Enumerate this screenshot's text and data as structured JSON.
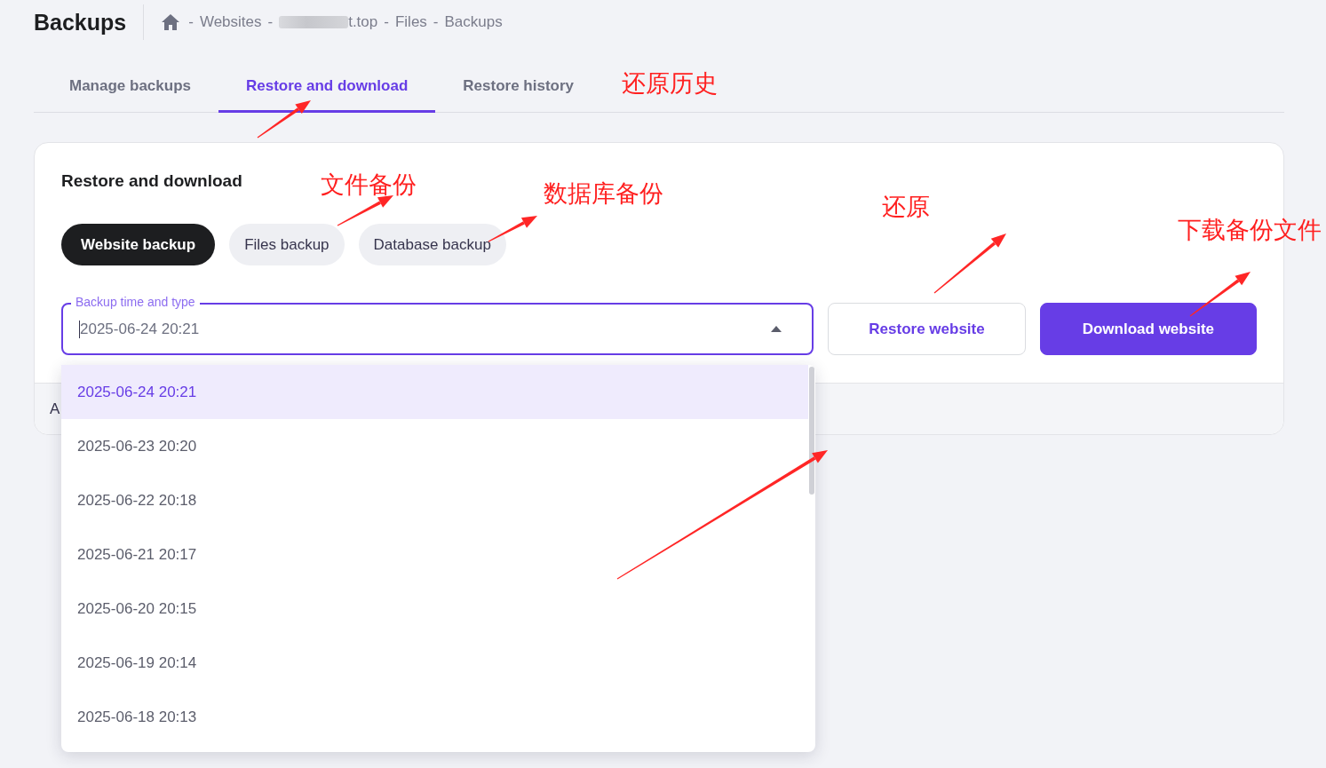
{
  "header": {
    "title": "Backups",
    "breadcrumb": [
      {
        "kind": "home"
      },
      {
        "kind": "separator",
        "text": "-"
      },
      {
        "kind": "link",
        "text": "Websites"
      },
      {
        "kind": "separator",
        "text": "-"
      },
      {
        "kind": "redacted",
        "text": "t.top"
      },
      {
        "kind": "separator",
        "text": "-"
      },
      {
        "kind": "link",
        "text": "Files"
      },
      {
        "kind": "separator",
        "text": "-"
      },
      {
        "kind": "current",
        "text": "Backups"
      }
    ]
  },
  "tabs": [
    {
      "label": "Manage backups",
      "selected": false
    },
    {
      "label": "Restore and download",
      "selected": true
    },
    {
      "label": "Restore history",
      "selected": false
    }
  ],
  "card": {
    "title": "Restore and download",
    "backup_types": [
      {
        "label": "Website backup",
        "selected": true
      },
      {
        "label": "Files backup",
        "selected": false
      },
      {
        "label": "Database backup",
        "selected": false
      }
    ],
    "select": {
      "label": "Backup time and type",
      "value": "2025-06-24 20:21",
      "expanded": true,
      "options": [
        {
          "label": "2025-06-24 20:21",
          "selected": true
        },
        {
          "label": "2025-06-23 20:20",
          "selected": false
        },
        {
          "label": "2025-06-22 20:18",
          "selected": false
        },
        {
          "label": "2025-06-21 20:17",
          "selected": false
        },
        {
          "label": "2025-06-20 20:15",
          "selected": false
        },
        {
          "label": "2025-06-19 20:14",
          "selected": false
        },
        {
          "label": "2025-06-18 20:13",
          "selected": false
        }
      ]
    },
    "buttons": [
      {
        "label": "Restore website",
        "kind": "secondary"
      },
      {
        "label": "Download website",
        "kind": "primary"
      }
    ],
    "footer_text": "A"
  },
  "annotations": [
    {
      "text": "还原历史"
    },
    {
      "text": "文件备份"
    },
    {
      "text": "数据库备份"
    },
    {
      "text": "还原"
    },
    {
      "text": "下载备份文件"
    }
  ]
}
